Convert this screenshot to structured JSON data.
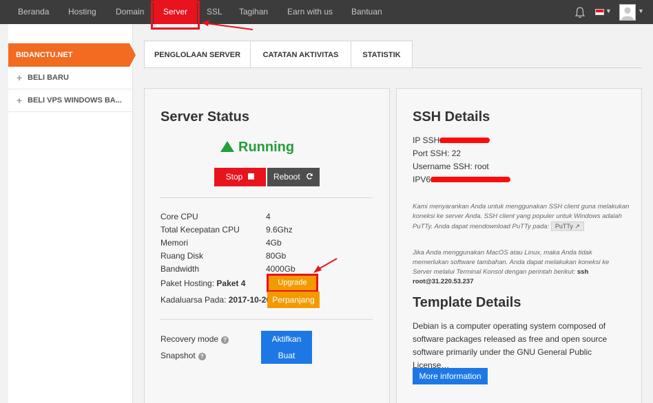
{
  "nav": {
    "items": [
      {
        "label": "Beranda"
      },
      {
        "label": "Hosting"
      },
      {
        "label": "Domain"
      },
      {
        "label": "Server"
      },
      {
        "label": "SSL"
      },
      {
        "label": "Tagihan"
      },
      {
        "label": "Earn with us"
      },
      {
        "label": "Bantuan"
      }
    ],
    "active_color": "#e8131d",
    "icons": [
      "bell-icon",
      "flag-indonesia-icon",
      "user-avatar-icon",
      "chevron-down-icon"
    ]
  },
  "sidebar": {
    "active": "BIDANCTU.NET",
    "items": [
      {
        "label": "BELI BARU"
      },
      {
        "label": "BELI VPS WINDOWS BA..."
      }
    ],
    "accent": "#f26b21"
  },
  "tabs": [
    {
      "label": "PENGLOLAAN SERVER"
    },
    {
      "label": "CATATAN AKTIVITAS"
    },
    {
      "label": "STATISTIK"
    }
  ],
  "server_status": {
    "title": "Server Status",
    "status": "Running",
    "status_color": "#21a038",
    "stop_label": "Stop",
    "reboot_label": "Reboot",
    "specs": [
      {
        "label": "Core CPU",
        "value": "4"
      },
      {
        "label": "Total Kecepatan CPU",
        "value": "9.6Ghz"
      },
      {
        "label": "Memori",
        "value": "4Gb"
      },
      {
        "label": "Ruang Disk",
        "value": "80Gb"
      },
      {
        "label": "Bandwidth",
        "value": "4000Gb"
      }
    ],
    "paket_label": "Paket Hosting:",
    "paket_value": "Paket 4",
    "upgrade_label": "Upgrade",
    "kadaluarsa_label": "Kadaluarsa Pada:",
    "kadaluarsa_value": "2017-10-20",
    "perpanjang_label": "Perpanjang",
    "recovery_label": "Recovery mode",
    "aktifkan_label": "Aktifkan",
    "snapshot_label": "Snapshot",
    "buat_label": "Buat"
  },
  "ssh": {
    "title": "SSH Details",
    "ip_label": "IP SSH:",
    "port_label": "Port SSH:",
    "port_value": "22",
    "username_label": "Username SSH:",
    "username_value": "root",
    "ipv6_label": "IPV6:",
    "note1": "Kami menyarankan Anda untuk menggunakan SSH client guna melakukan koneksi ke server Anda. SSH client yang populer untuk Windows adalah PuTTy. Anda dapat mendownload PuTTy pada:",
    "putty_label": "PuTTy",
    "note2": "Jika Anda menggunakan MacOS atau Linux, maka Anda tidak memerlukan software tambahan. Anda dapat melakukan koneksi ke Server melalui Terminal Konsol dengan perintah berikut:",
    "command": "ssh root@31.220.53.237"
  },
  "template": {
    "title": "Template Details",
    "description": "Debian is a computer operating system composed of software packages released as free and open source software primarily under the GNU General Public License…",
    "more_label": "More information"
  }
}
